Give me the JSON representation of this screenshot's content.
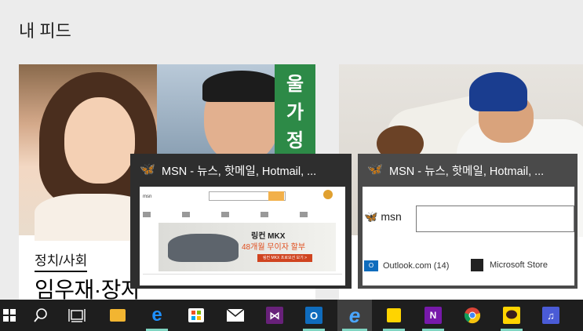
{
  "page": {
    "feed_title": "내 피드"
  },
  "card_left": {
    "sign_text": "울가정",
    "category": "정치/사회",
    "headline": "임우재·장자"
  },
  "thumbnails": [
    {
      "title": "MSN - 뉴스, 핫메일, Hotmail, ...",
      "preview": {
        "logo": "msn",
        "ad_title": "링컨 MKX",
        "ad_subtitle": "48개월 무이자 할부",
        "ad_button": "링컨 MKX 프로모션 보기 >"
      }
    },
    {
      "title": "MSN - 뉴스, 핫메일, Hotmail, ...",
      "preview": {
        "logo": "msn",
        "outlook_label": "Outlook.com (14)",
        "store_label": "Microsoft Store"
      }
    }
  ],
  "taskbar": {
    "items": [
      {
        "name": "start",
        "icon": "windows-logo-icon",
        "running": false
      },
      {
        "name": "search",
        "icon": "search-icon",
        "running": false
      },
      {
        "name": "task-view",
        "icon": "task-view-icon",
        "running": false
      },
      {
        "name": "file-explorer",
        "icon": "folder-icon",
        "running": false
      },
      {
        "name": "edge",
        "icon": "edge-icon",
        "running": true
      },
      {
        "name": "store",
        "icon": "store-bag-icon",
        "running": false
      },
      {
        "name": "mail",
        "icon": "mail-icon",
        "running": false
      },
      {
        "name": "visual-studio",
        "icon": "visual-studio-icon",
        "running": false
      },
      {
        "name": "outlook",
        "icon": "outlook-icon",
        "running": true
      },
      {
        "name": "internet-explorer",
        "icon": "ie-icon",
        "running": true,
        "active": true
      },
      {
        "name": "sticky-notes",
        "icon": "sticky-notes-icon",
        "running": true
      },
      {
        "name": "onenote",
        "icon": "onenote-icon",
        "running": true
      },
      {
        "name": "chrome",
        "icon": "chrome-icon",
        "running": false
      },
      {
        "name": "kakaotalk",
        "icon": "chat-icon",
        "running": true
      },
      {
        "name": "media-app",
        "icon": "media-app-icon",
        "running": false
      }
    ]
  },
  "colors": {
    "taskbar_bg": "#1e1e1e",
    "running_indicator": "#7fd4c1",
    "accent": "#0078d7"
  }
}
